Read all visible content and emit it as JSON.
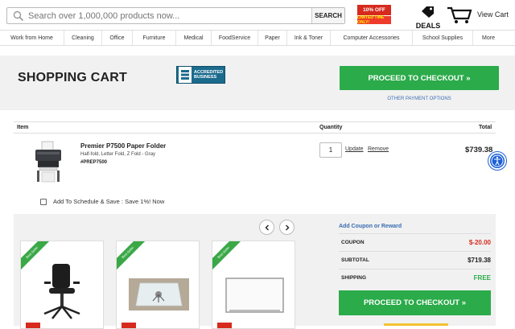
{
  "header": {
    "search_placeholder": "Search over 1,000,000 products now...",
    "search_button": "SEARCH",
    "promo_top": "10% OFF",
    "promo_bottom": "LIMITED TIME ONLY!",
    "deals_label": "DEALS",
    "view_cart": "View Cart"
  },
  "nav": {
    "items": [
      "Work from Home",
      "Cleaning",
      "Office",
      "Furniture",
      "Medical",
      "FoodService",
      "Paper",
      "Ink & Toner",
      "Computer Accessories",
      "School Supplies",
      "More"
    ]
  },
  "page": {
    "title": "SHOPPING CART",
    "bbb_line1": "ACCREDITED",
    "bbb_line2": "BUSINESS",
    "checkout_label": "PROCEED TO CHECKOUT »",
    "other_payment": "OTHER PAYMENT OPTIONS"
  },
  "table": {
    "col_item": "Item",
    "col_quantity": "Quantity",
    "col_total": "Total"
  },
  "cart_item": {
    "name": "Premier P7500 Paper Folder",
    "description": "Half-fold, Letter Fold, Z Fold - Gray",
    "sku": "#PREP7500",
    "quantity": "1",
    "update_label": "Update",
    "remove_label": "Remove",
    "total": "$739.38"
  },
  "schedule": {
    "label": "Add To Schedule & Save : Save 1%! Now"
  },
  "recommendations": {
    "badge": "Best Seller"
  },
  "summary": {
    "coupon_link": "Add Coupon or Reward",
    "coupon_label": "COUPON",
    "coupon_value": "$-20.00",
    "subtotal_label": "SUBTOTAL",
    "subtotal_value": "$719.38",
    "shipping_label": "SHIPPING",
    "shipping_value": "FREE",
    "checkout_label": "PROCEED TO CHECKOUT »"
  },
  "colors": {
    "accent_green": "#2bab4a",
    "link_blue": "#3a6cb3",
    "coupon_red": "#d62a1e"
  }
}
